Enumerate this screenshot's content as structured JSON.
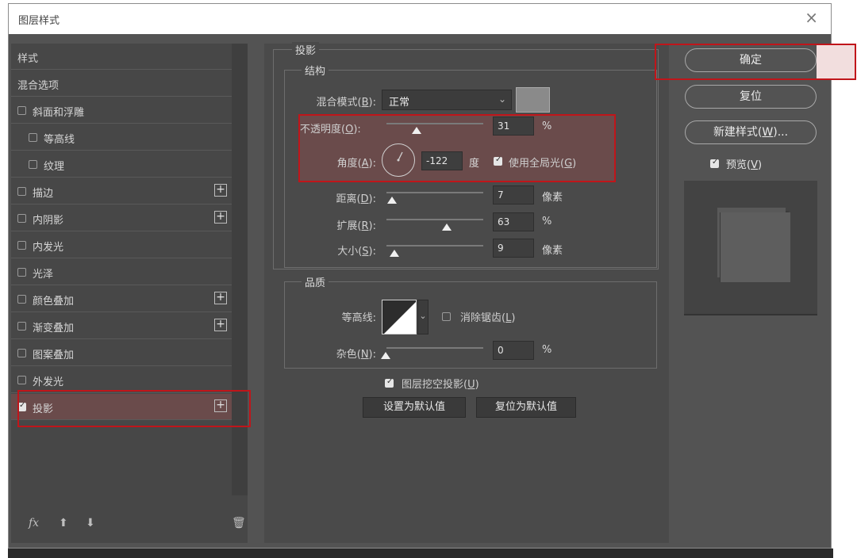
{
  "window": {
    "title": "图层样式",
    "close_glyph": "×"
  },
  "style_list": {
    "header": "样式",
    "blend_options": "混合选项",
    "items": [
      {
        "label": "斜面和浮雕",
        "checked": false,
        "plus": false
      },
      {
        "label": "等高线",
        "checked": false,
        "plus": false,
        "indent": true
      },
      {
        "label": "纹理",
        "checked": false,
        "plus": false,
        "indent": true
      },
      {
        "label": "描边",
        "checked": false,
        "plus": true
      },
      {
        "label": "内阴影",
        "checked": false,
        "plus": true
      },
      {
        "label": "内发光",
        "checked": false,
        "plus": false
      },
      {
        "label": "光泽",
        "checked": false,
        "plus": false
      },
      {
        "label": "颜色叠加",
        "checked": false,
        "plus": true
      },
      {
        "label": "渐变叠加",
        "checked": false,
        "plus": true
      },
      {
        "label": "图案叠加",
        "checked": false,
        "plus": false
      },
      {
        "label": "外发光",
        "checked": false,
        "plus": false
      },
      {
        "label": "投影",
        "checked": true,
        "plus": true,
        "selected": true
      }
    ],
    "tools": {
      "fx": "fx",
      "up": "⬆",
      "down": "⬇",
      "trash": "🗑"
    }
  },
  "drop_shadow": {
    "section_title": "投影",
    "structure_title": "结构",
    "blend_mode_label": "混合模式(",
    "blend_mode_key": "B",
    "blend_mode_value": "正常",
    "shadow_color": "#8a8a8a",
    "opacity_label": "不透明度(",
    "opacity_key": "O",
    "opacity_value": "31",
    "opacity_unit": "%",
    "angle_label": "角度(",
    "angle_key": "A",
    "angle_value": "-122",
    "angle_unit": "度",
    "global_light_label": "使用全局光(",
    "global_light_key": "G",
    "global_light_checked": true,
    "distance_label": "距离(",
    "distance_key": "D",
    "distance_value": "7",
    "distance_unit": "像素",
    "spread_label": "扩展(",
    "spread_key": "R",
    "spread_value": "63",
    "spread_unit": "%",
    "size_label": "大小(",
    "size_key": "S",
    "size_value": "9",
    "size_unit": "像素",
    "quality_title": "品质",
    "contour_label": "等高线:",
    "anti_alias_label": "消除锯齿(",
    "anti_alias_key": "L",
    "anti_alias_checked": false,
    "noise_label": "杂色(",
    "noise_key": "N",
    "noise_value": "0",
    "noise_unit": "%",
    "knockout_label": "图层挖空投影(",
    "knockout_key": "U",
    "knockout_checked": true,
    "make_default": "设置为默认值",
    "reset_default": "复位为默认值"
  },
  "right": {
    "ok": "确定",
    "reset": "复位",
    "new_style": "新建样式(",
    "new_style_key": "W",
    "new_style_tail": ")...",
    "preview_label": "预览(",
    "preview_key": "V",
    "preview_checked": true
  },
  "colors": {
    "highlight": "#c0151a",
    "panel": "#535353"
  }
}
